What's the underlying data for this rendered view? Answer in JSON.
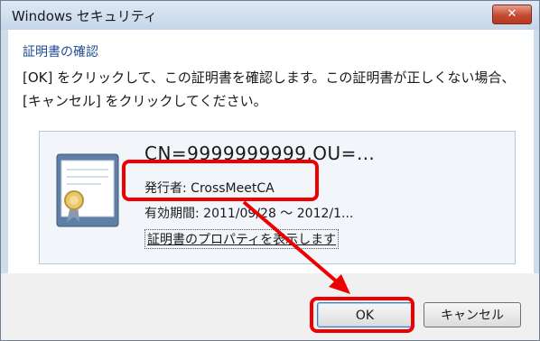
{
  "window": {
    "title": "Windows セキュリティ",
    "close_symbol": "✕"
  },
  "dialog": {
    "heading": "証明書の確認",
    "message": "[OK] をクリックして、この証明書を確認します。この証明書が正しくない場合、[キャンセル] をクリックしてください。"
  },
  "certificate": {
    "name": "CN=9999999999,OU=…",
    "issuer": "発行者: CrossMeetCA",
    "validity": "有効期間: 2011/09/28 ～ 2012/1...",
    "properties_link": "証明書のプロパティを表示します"
  },
  "buttons": {
    "ok": "OK",
    "cancel": "キャンセル"
  },
  "colors": {
    "annotation": "#ee0000",
    "heading": "#1f4b96"
  }
}
